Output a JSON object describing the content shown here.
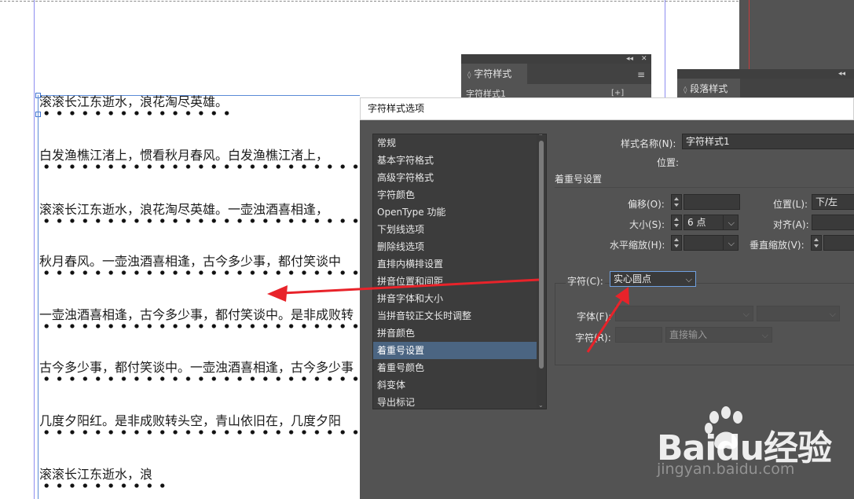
{
  "document": {
    "lines": [
      "滚滚长江东逝水，浪花淘尽英雄。",
      "白发渔樵江渚上，惯看秋月春风。白发渔樵江渚上，",
      "滚滚长江东逝水，浪花淘尽英雄。一壶浊酒喜相逢，",
      "秋月春风。一壶浊酒喜相逢，古今多少事，都付笑谈中",
      "一壶浊酒喜相逢，古今多少事，都付笑谈中。是非成败转",
      "古今多少事，都付笑谈中。一壶浊酒喜相逢，古今多少事",
      "几度夕阳红。是非成败转头空，青山依旧在，几度夕阳",
      "滚滚长江东逝水，浪"
    ]
  },
  "panels": {
    "char_styles": {
      "tab": "字符样式",
      "subitem": "字符样式1"
    },
    "para_styles": {
      "tab": "段落样式"
    }
  },
  "dialog": {
    "title": "字符样式选项",
    "categories": [
      "常规",
      "基本字符格式",
      "高级字符格式",
      "字符颜色",
      "OpenType 功能",
      "下划线选项",
      "删除线选项",
      "直排内横排设置",
      "拼音位置和间距",
      "拼音字体和大小",
      "当拼音较正文长时调整",
      "拼音颜色",
      "着重号设置",
      "着重号颜色",
      "斜变体",
      "导出标记"
    ],
    "selected_category": "着重号设置",
    "style_name_label": "样式名称(N):",
    "style_name_value": "字符样式1",
    "location_label": "位置:",
    "section_title": "着重号设置",
    "offset_label": "偏移(O):",
    "offset_value": "",
    "position_label": "位置(L):",
    "position_value": "下/左",
    "size_label": "大小(S):",
    "size_value": "6 点",
    "align_label": "对齐(A):",
    "align_value": "",
    "hscale_label": "水平缩放(H):",
    "hscale_value": "",
    "vscale_label": "垂直缩放(V):",
    "vscale_value": "",
    "character_label": "字符(C):",
    "character_value": "实心圆点",
    "font_label": "字体(F):",
    "font_value": "",
    "font_style_value": "",
    "char_label": "字符(R):",
    "char_value": "",
    "input_mode_value": "直接输入"
  },
  "watermark": {
    "brand": "Baidu经验",
    "url": "jingyan.baidu.com"
  },
  "colors": {
    "dialog_bg": "#535353",
    "selected_item": "#4b6582",
    "annotation_arrow": "#e8232a"
  }
}
